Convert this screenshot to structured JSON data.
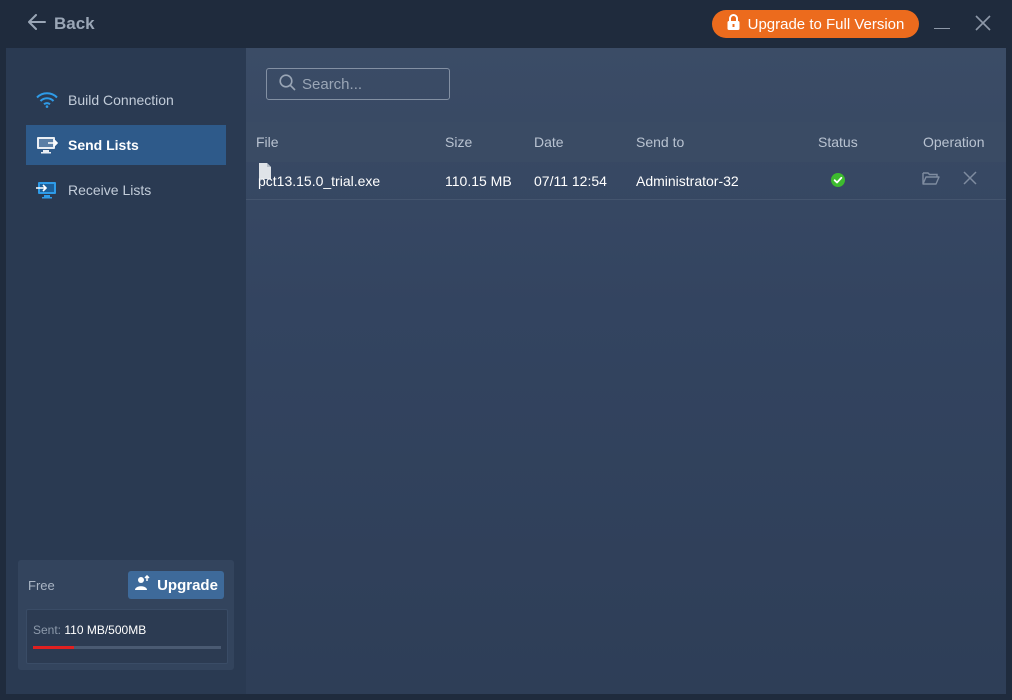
{
  "titlebar": {
    "back_label": "Back",
    "upgrade_full_label": "Upgrade to Full Version"
  },
  "sidebar": {
    "items": [
      {
        "label": "Build Connection",
        "icon": "wifi-icon"
      },
      {
        "label": "Send Lists",
        "icon": "send-monitor-icon"
      },
      {
        "label": "Receive Lists",
        "icon": "receive-monitor-icon"
      }
    ],
    "active_index": 1,
    "plan": {
      "tier": "Free",
      "upgrade_label": "Upgrade",
      "usage_label": "Sent:",
      "usage_value": "110 MB/500MB",
      "usage_fraction": 0.22
    }
  },
  "search": {
    "placeholder": "Search..."
  },
  "table": {
    "columns": [
      "File",
      "Size",
      "Date",
      "Send to",
      "Status",
      "Operation"
    ],
    "rows": [
      {
        "file": "pct13.15.0_trial.exe",
        "size": "110.15 MB",
        "date": "07/11 12:54",
        "send_to": "Administrator-32",
        "status": "success"
      }
    ]
  },
  "colors": {
    "accent_orange": "#ec6b1d",
    "active_nav": "#2e5a8a",
    "success_green": "#3dbb2e",
    "usage_red": "#e02020"
  }
}
